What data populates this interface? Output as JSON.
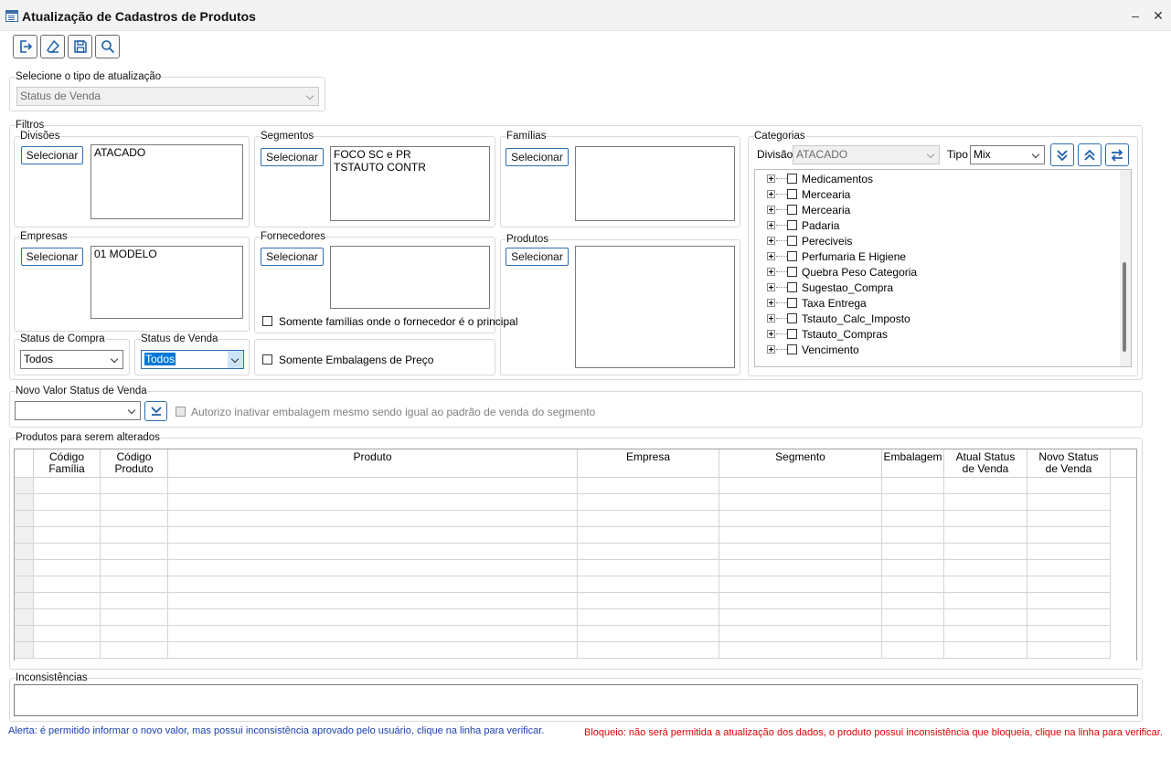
{
  "window": {
    "title": "Atualização de Cadastros de Produtos",
    "minimize": "–",
    "close": "✕"
  },
  "toolbar": {
    "icons": [
      "exit-icon",
      "eraser-icon",
      "save-icon",
      "search-icon"
    ]
  },
  "tipo": {
    "legend": "Selecione o tipo de atualização",
    "value": "Status de Venda"
  },
  "filtros": {
    "legend": "Filtros",
    "divisoes": {
      "legend": "Divisões",
      "button": "Selecionar",
      "items": [
        "ATACADO"
      ]
    },
    "segmentos": {
      "legend": "Segmentos",
      "button": "Selecionar",
      "items": [
        "FOCO SC e PR",
        "TSTAUTO CONTR"
      ]
    },
    "familias": {
      "legend": "Famílias",
      "button": "Selecionar",
      "items": []
    },
    "empresas": {
      "legend": "Empresas",
      "button": "Selecionar",
      "items": [
        "01 MODELO"
      ]
    },
    "fornecedores": {
      "legend": "Fornecedores",
      "button": "Selecionar",
      "items": [],
      "checkbox": "Somente famílias onde o fornecedor é o principal"
    },
    "produtos": {
      "legend": "Produtos",
      "button": "Selecionar",
      "items": []
    },
    "status_compra": {
      "legend": "Status de Compra",
      "value": "Todos"
    },
    "status_venda": {
      "legend": "Status de Venda",
      "value": "Todos"
    },
    "embalagens": {
      "checkbox": "Somente Embalagens de Preço"
    },
    "categorias": {
      "legend": "Categorias",
      "divisao_label": "Divisão",
      "divisao_value": "ATACADO",
      "tipo_label": "Tipo",
      "tipo_value": "Mix",
      "tree": [
        "Medicamentos",
        "Mercearia",
        "Mercearia",
        "Padaria",
        "Pereciveis",
        "Perfumaria E Higiene",
        "Quebra Peso Categoria",
        "Sugestao_Compra",
        "Taxa Entrega",
        "Tstauto_Calc_Imposto",
        "Tstauto_Compras",
        "Vencimento"
      ]
    }
  },
  "novo_valor": {
    "legend": "Novo Valor Status de Venda",
    "value": "",
    "checkbox": "Autorizo inativar embalagem mesmo sendo igual ao padrão de venda do segmento"
  },
  "grid": {
    "legend": "Produtos para serem alterados",
    "columns": [
      {
        "l1": "Código",
        "l2": "Família"
      },
      {
        "l1": "Código",
        "l2": "Produto"
      },
      {
        "l1": "Produto",
        "l2": ""
      },
      {
        "l1": "Empresa",
        "l2": ""
      },
      {
        "l1": "Segmento",
        "l2": ""
      },
      {
        "l1": "Embalagem",
        "l2": ""
      },
      {
        "l1": "Atual Status",
        "l2": "de Venda"
      },
      {
        "l1": "Novo Status",
        "l2": "de Venda"
      }
    ]
  },
  "inconsistencias": {
    "legend": "Inconsistências"
  },
  "footer": {
    "alerta": "Alerta: é permitido informar o novo valor, mas possui inconsistência aprovado pelo usuário, clique na linha para verificar.",
    "bloqueio": "Bloqueio: não será permitida a atualização dos dados, o produto possui inconsistência que bloqueia, clique na linha para verificar.",
    "alerta_color": "#1a3fb0",
    "bloqueio_color": "#e00000"
  }
}
